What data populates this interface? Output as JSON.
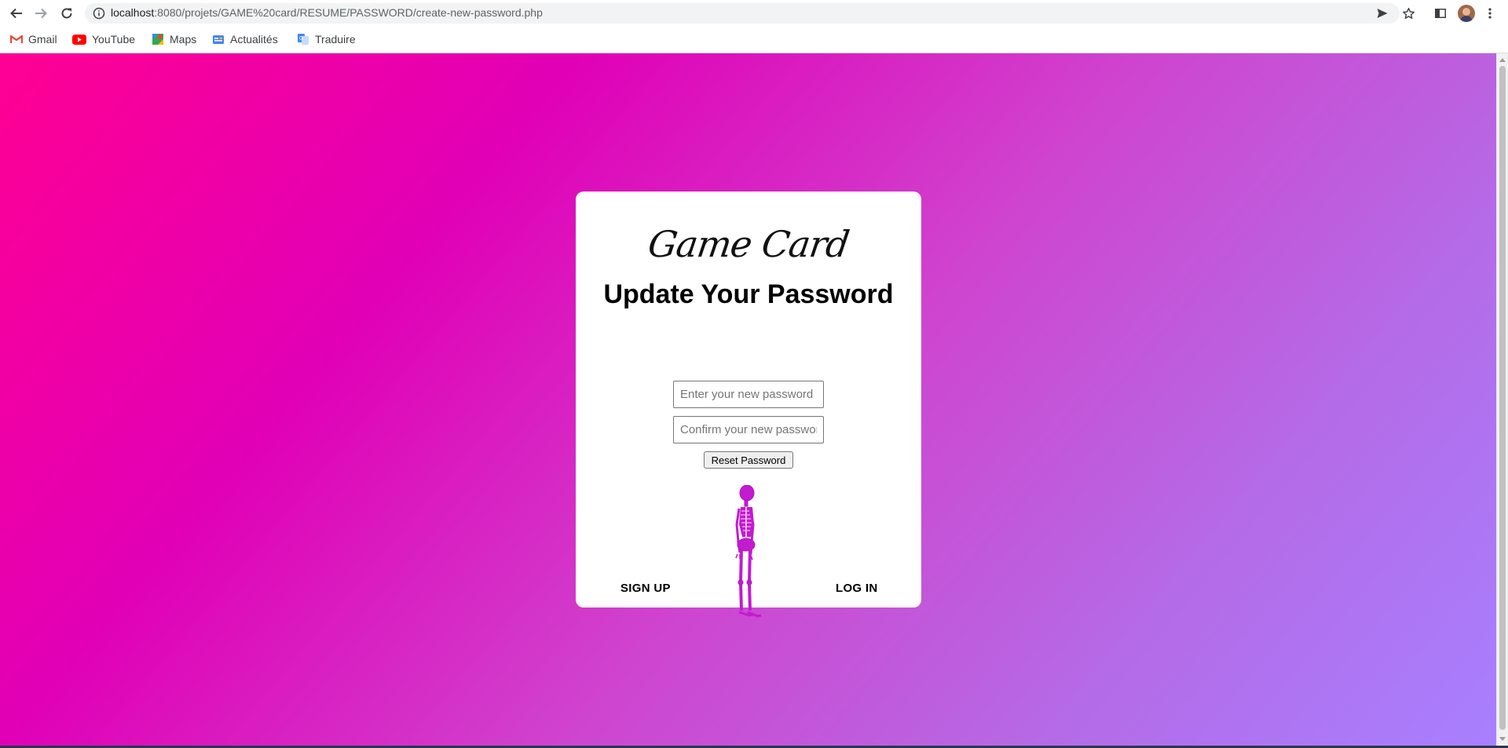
{
  "browser": {
    "url_host": "localhost",
    "url_path": ":8080/projets/GAME%20card/RESUME/PASSWORD/create-new-password.php",
    "bookmarks": [
      "Gmail",
      "YouTube",
      "Maps",
      "Actualités",
      "Traduire"
    ],
    "icons": {
      "back": "arrow-left-icon",
      "forward": "arrow-right-icon",
      "reload": "reload-icon",
      "info": "info-icon",
      "send": "send-icon",
      "star": "star-icon",
      "sidepanel": "side-panel-icon",
      "menu": "kebab-menu-icon"
    }
  },
  "colors": {
    "gradient": [
      "#ff0093",
      "#e100b6",
      "#cf44cf",
      "#b56ae6",
      "#a780ff"
    ],
    "skeleton": "#c21bd0"
  },
  "card": {
    "logo": "Game Card",
    "heading": "Update Your Password",
    "new_password_placeholder": "Enter your new password",
    "confirm_password_placeholder": "Confirm your new password",
    "reset_button": "Reset Password",
    "signup": "SIGN UP",
    "login": "LOG IN"
  }
}
